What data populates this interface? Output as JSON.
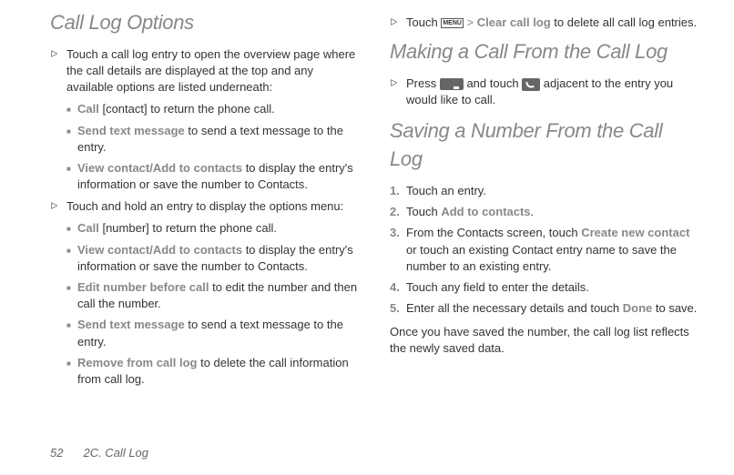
{
  "footer": {
    "pageNum": "52",
    "section": "2C. Call Log"
  },
  "left": {
    "heading": "Call Log Options",
    "a1": "Touch a call log entry to open the overview page where the call details are displayed at the top and any available options are listed underneath:",
    "a1s1_bold": "Call",
    "a1s1_rest": " [contact] to return the phone call.",
    "a1s2_bold": "Send text message",
    "a1s2_rest": " to send a text message to the entry.",
    "a1s3_bold": "View contact/Add to contacts",
    "a1s3_rest": " to display the entry's information or save the number to Contacts.",
    "a2": "Touch and hold an entry to display the options menu:",
    "a2s1_bold": "Call",
    "a2s1_rest": " [number] to return the phone call.",
    "a2s2_bold": "View contact/Add to contacts",
    "a2s2_rest": " to display the entry's information or save the number to Contacts.",
    "a2s3_bold": "Edit number before call",
    "a2s3_rest": " to edit the number and then call the number.",
    "a2s4_bold": "Send text message",
    "a2s4_rest": " to send a text message to the entry.",
    "a2s5_bold": "Remove from call log",
    "a2s5_rest": " to delete the call information from call log."
  },
  "right": {
    "top_pre": "Touch ",
    "top_menu": "MENU",
    "top_gt": " > ",
    "top_bold": "Clear call log",
    "top_post": " to delete all call log entries.",
    "h2": "Making a Call From the Call Log",
    "h2a_pre": "Press ",
    "h2a_mid": " and touch ",
    "h2a_post": " adjacent to the entry you would like to call.",
    "h3": "Saving a Number From the Call Log",
    "s1": "Touch an entry.",
    "s2_pre": "Touch ",
    "s2_bold": "Add to contacts",
    "s2_post": ".",
    "s3_pre": "From the Contacts screen, touch ",
    "s3_bold": "Create new contact",
    "s3_post": " or touch an existing Contact entry name to save the number to an existing entry.",
    "s4": "Touch any field to enter the details.",
    "s5_pre": "Enter all the necessary details and touch ",
    "s5_bold": "Done",
    "s5_post": " to save.",
    "closing": "Once you have saved the number, the call log list reflects the newly saved data.",
    "n1": "1.",
    "n2": "2.",
    "n3": "3.",
    "n4": "4.",
    "n5": "5."
  }
}
